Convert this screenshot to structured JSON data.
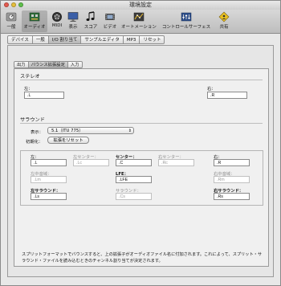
{
  "window": {
    "title": "環境設定"
  },
  "toolbar": [
    {
      "label": "一般",
      "icon": "general-switch-icon"
    },
    {
      "label": "オーディオ",
      "icon": "audio-board-icon",
      "active": true
    },
    {
      "label": "MIDI",
      "icon": "midi-port-icon"
    },
    {
      "label": "表示",
      "icon": "monitor-icon"
    },
    {
      "label": "スコア",
      "icon": "score-notes-icon"
    },
    {
      "label": "ビデオ",
      "icon": "video-film-icon"
    },
    {
      "label": "オートメーション",
      "icon": "automation-icon"
    },
    {
      "label": "コントロールサーフェス",
      "icon": "control-surface-icon"
    },
    {
      "label": "共有",
      "icon": "sharing-icon"
    }
  ],
  "tabs": [
    "デバイス",
    "一般",
    "I/O 割り当て",
    "サンプルエディタ",
    "MP3",
    "リセット"
  ],
  "subtabs": [
    "出力",
    "バウンス拡張設定",
    "入力"
  ],
  "stereo": {
    "heading": "ステレオ",
    "left_label": "左：",
    "left_value": ".L",
    "right_label": "右：",
    "right_value": ".R"
  },
  "surround": {
    "heading": "サラウンド",
    "display_label": "表示：",
    "display_value": "5.1（ITU 775）",
    "init_label": "初期化：",
    "reset_button": "拡張をリセット",
    "channels": [
      {
        "label": "左：",
        "value": ".L",
        "enabled": true,
        "bold": false
      },
      {
        "label": "左センター：",
        "value": ".Lc",
        "enabled": false,
        "bold": false
      },
      {
        "label": "センター：",
        "value": ".C",
        "enabled": true,
        "bold": true
      },
      {
        "label": "右センター：",
        "value": ".Rc",
        "enabled": false,
        "bold": false
      },
      {
        "label": "右：",
        "value": ".R",
        "enabled": true,
        "bold": false
      },
      {
        "label": "左中音域：",
        "value": ".Lm",
        "enabled": false,
        "bold": false
      },
      {
        "label": "LFE：",
        "value": ".LFE",
        "enabled": true,
        "bold": true
      },
      {
        "label": "右中音域：",
        "value": ".Rm",
        "enabled": false,
        "bold": false
      },
      {
        "label": "左サラウンド：",
        "value": ".Ls",
        "enabled": true,
        "bold": true
      },
      {
        "label": "サラウンド：",
        "value": ".Cs",
        "enabled": false,
        "bold": false
      },
      {
        "label": "右サラウンド：",
        "value": ".Rs",
        "enabled": true,
        "bold": true
      }
    ]
  },
  "note": "スプリットフォーマットでバウンスすると、上の拡張子がオーディオファイル名に付加されます。これによって、スプリット・サラウンド・ファイルを読み込むときのチャンネル割り当てが決定されます。",
  "colors": {
    "titlebar": "#d6d6d6",
    "toolbar": "#c7c7c7",
    "panel": "#e6e6e6",
    "light_red": "#e55a4f",
    "light_yellow": "#e6bf3c",
    "light_green": "#5fc04c"
  }
}
